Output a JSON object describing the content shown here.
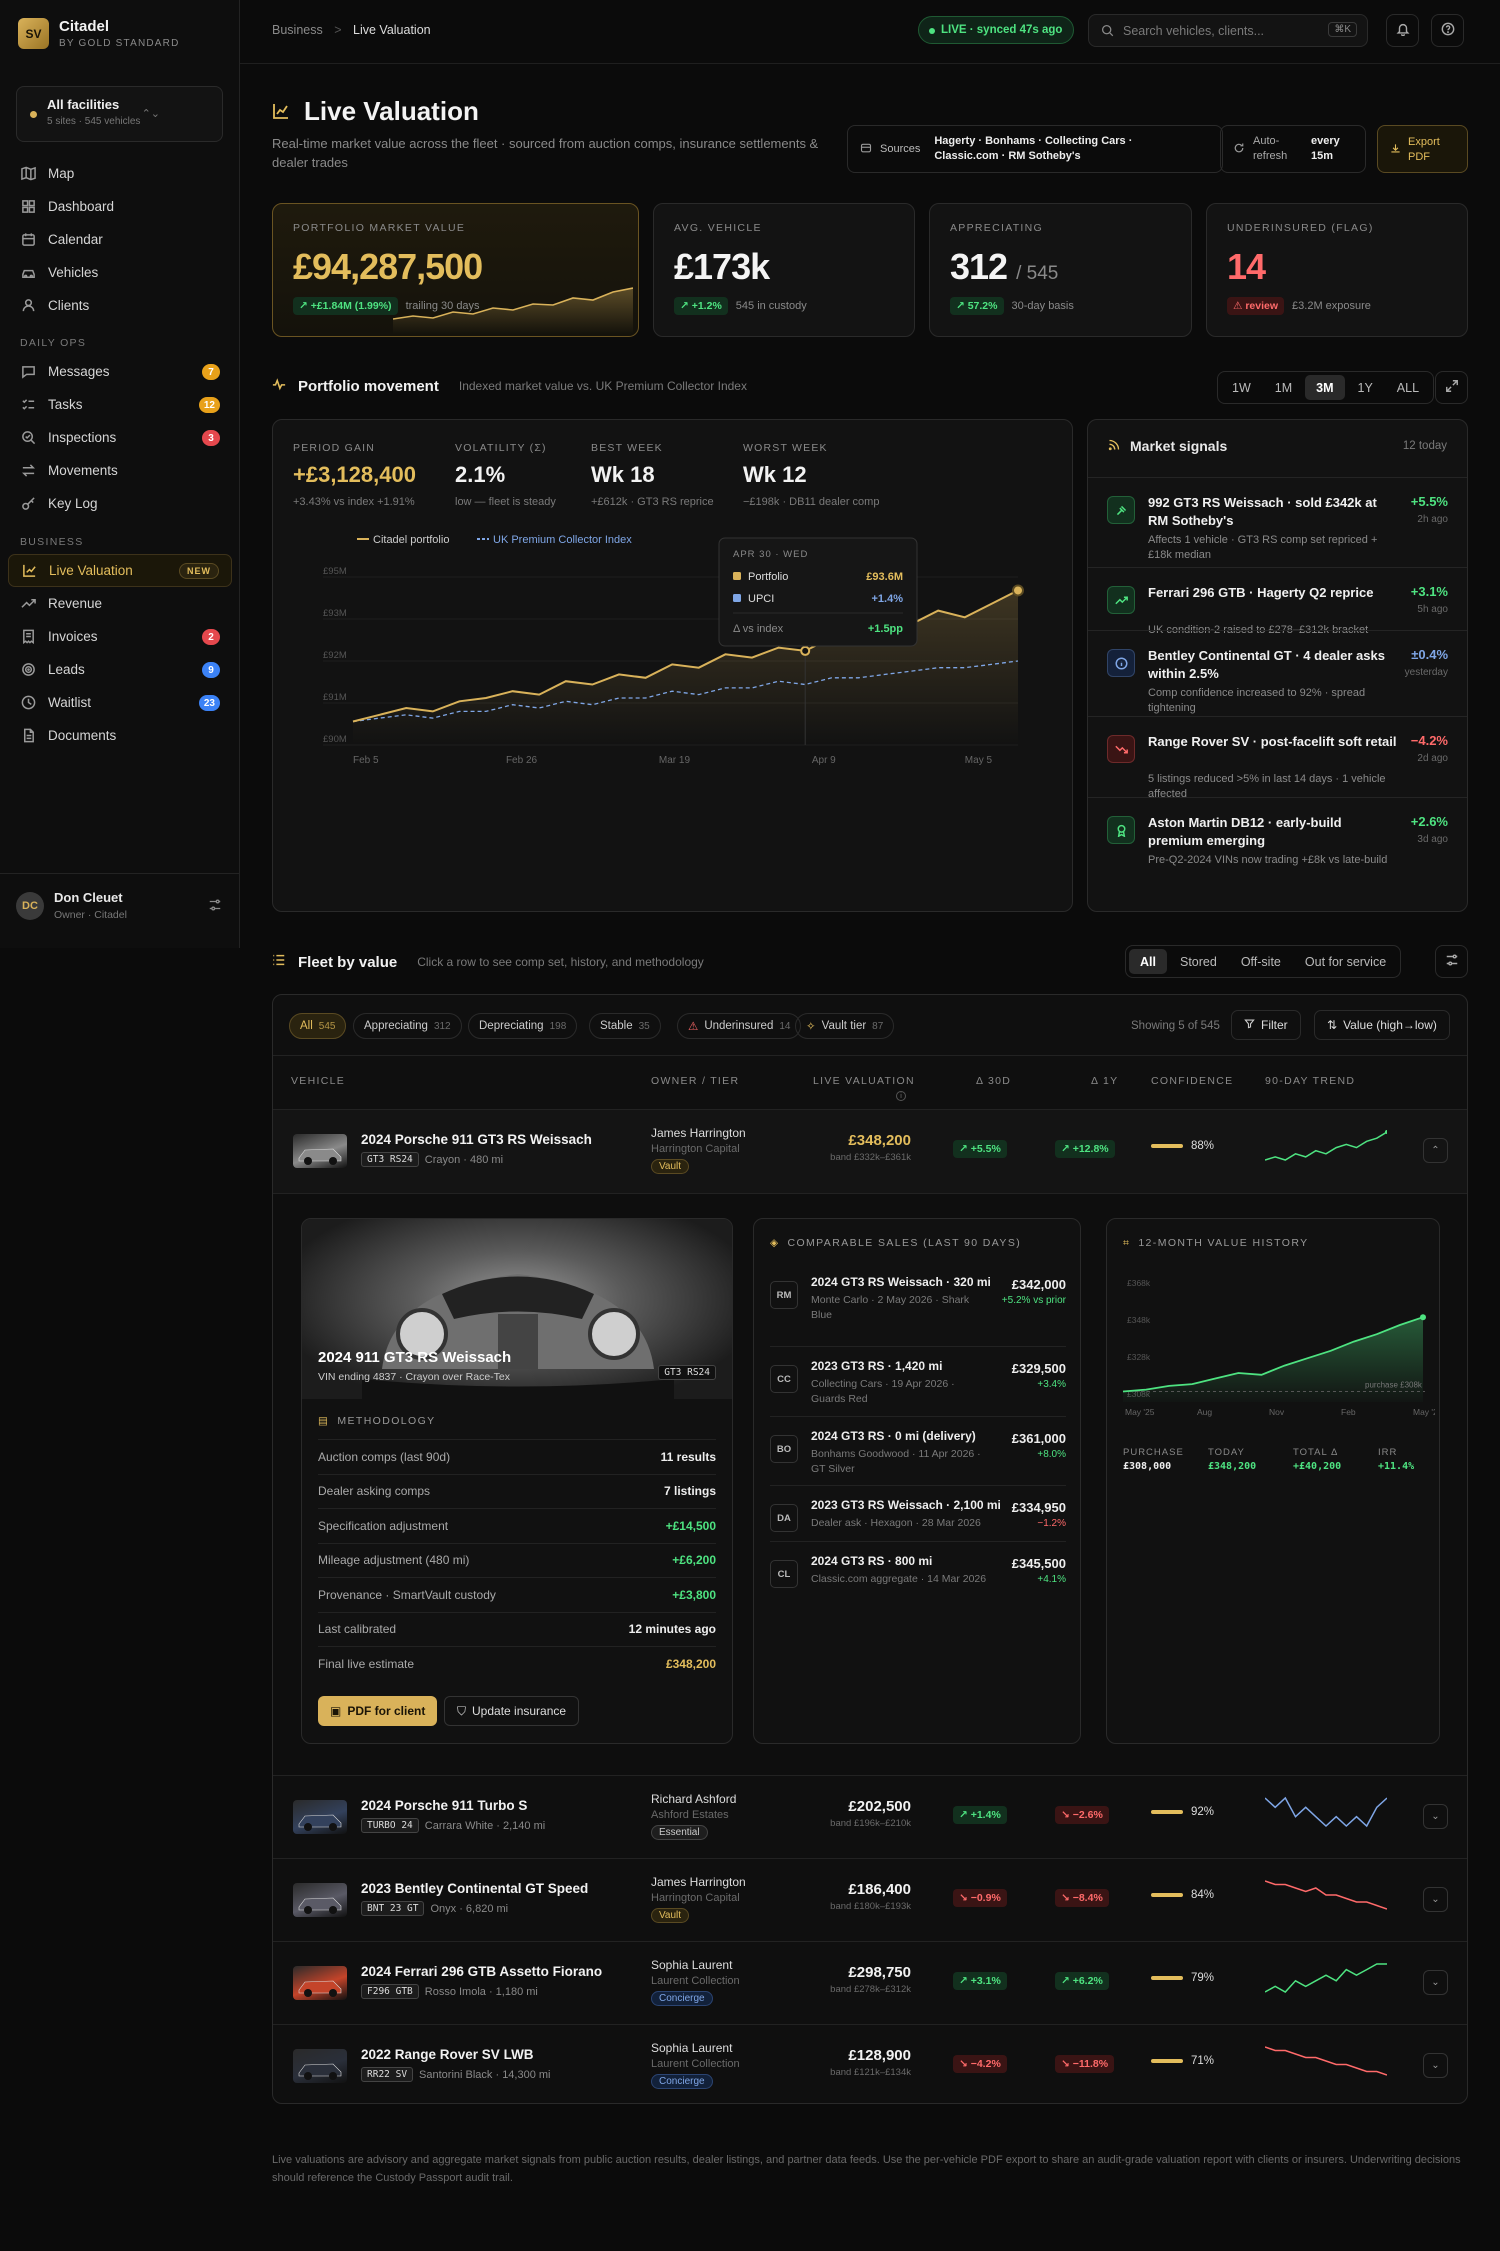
{
  "brand": {
    "logo": "SV",
    "name": "Citadel",
    "sub": "BY GOLD STANDARD"
  },
  "facility": {
    "title": "All facilities",
    "sub": "5 sites · 545 vehicles"
  },
  "nav_main": [
    {
      "label": "Map",
      "icon": "map-icon"
    },
    {
      "label": "Dashboard",
      "icon": "dashboard-icon"
    },
    {
      "label": "Calendar",
      "icon": "calendar-icon"
    },
    {
      "label": "Vehicles",
      "icon": "car-icon"
    },
    {
      "label": "Clients",
      "icon": "users-icon"
    }
  ],
  "nav_ops_title": "DAILY OPS",
  "nav_ops": [
    {
      "label": "Messages",
      "badge": "7",
      "badge_color": "#e8a11a"
    },
    {
      "label": "Tasks",
      "badge": "12",
      "badge_color": "#e8a11a"
    },
    {
      "label": "Inspections",
      "badge": "3",
      "badge_color": "#e5484d"
    },
    {
      "label": "Movements"
    },
    {
      "label": "Key Log"
    }
  ],
  "nav_biz_title": "BUSINESS",
  "nav_biz": [
    {
      "label": "Live Valuation",
      "tag": "NEW"
    },
    {
      "label": "Revenue"
    },
    {
      "label": "Invoices",
      "badge": "2",
      "badge_color": "#e5484d"
    },
    {
      "label": "Leads",
      "badge": "9",
      "badge_color": "#3b82f6"
    },
    {
      "label": "Waitlist",
      "badge": "23",
      "badge_color": "#3b82f6"
    },
    {
      "label": "Documents"
    }
  ],
  "user": {
    "initials": "DC",
    "name": "Don Cleuet",
    "role": "Owner · Citadel"
  },
  "breadcrumb": {
    "root": "Business",
    "sep": ">",
    "current": "Live Valuation"
  },
  "live_status": "LIVE · synced 47s ago",
  "search": {
    "placeholder": "Search vehicles, clients...",
    "kbd": "⌘K"
  },
  "page": {
    "title": "Live Valuation",
    "subtitle": "Real-time market value across the fleet · sourced from auction comps, insurance settlements & dealer trades"
  },
  "sources": {
    "label": "Sources",
    "value": "Hagerty · Bonhams · Collecting Cars · Classic.com · RM Sotheby's"
  },
  "autorefresh": {
    "label": "Auto-refresh",
    "value": "every 15m"
  },
  "export_label": "Export PDF",
  "kpis": [
    {
      "label": "PORTFOLIO MARKET VALUE",
      "value": "£94,287,500",
      "pill": "↗ +£1.84M (1.99%)",
      "note": "trailing 30 days"
    },
    {
      "label": "AVG. VEHICLE",
      "value": "£173k",
      "pill": "↗ +1.2%",
      "note": "545 in custody"
    },
    {
      "label": "APPRECIATING",
      "value": "312",
      "value_suffix": "/ 545",
      "pill": "↗ 57.2%",
      "note": "30-day basis"
    },
    {
      "label": "UNDERINSURED (FLAG)",
      "value": "14",
      "pill": "⚠ review",
      "note": "£3.2M exposure",
      "value_color": "#ff6a6a"
    }
  ],
  "movement": {
    "title": "Portfolio movement",
    "sub": "Indexed market value vs. UK Premium Collector Index",
    "ranges": [
      "1W",
      "1M",
      "3M",
      "1Y",
      "ALL"
    ],
    "active_range": "3M"
  },
  "movement_stats": [
    {
      "label": "PERIOD GAIN",
      "value": "+£3,128,400",
      "sub": "+3.43% vs index +1.91%",
      "color": "#e3bd5c"
    },
    {
      "label": "VOLATILITY (Σ)",
      "value": "2.1%",
      "sub": "low — fleet is steady"
    },
    {
      "label": "BEST WEEK",
      "value": "Wk 18",
      "sub": "+£612k · GT3 RS reprice"
    },
    {
      "label": "WORST WEEK",
      "value": "Wk 12",
      "sub": "−£198k · DB11 dealer comp"
    }
  ],
  "chart_data": {
    "type": "line",
    "legend": [
      "Citadel portfolio",
      "UK Premium Collector Index"
    ],
    "y_ticks": [
      "£95M",
      "£93M",
      "£92M",
      "£91M",
      "£90M"
    ],
    "ylim": [
      90,
      95
    ],
    "x_ticks": [
      "Feb 5",
      "Feb 26",
      "Mar 19",
      "Apr 9",
      "May 5"
    ],
    "series": [
      {
        "name": "Citadel portfolio",
        "color": "#d9b25a",
        "values": [
          90.7,
          90.9,
          91.1,
          91.0,
          91.3,
          91.4,
          91.6,
          91.5,
          91.9,
          91.8,
          92.1,
          92.0,
          92.4,
          92.3,
          92.7,
          92.6,
          92.9,
          92.8,
          93.2,
          93.1,
          93.5,
          93.6,
          94.0,
          93.8,
          94.2,
          94.6
        ]
      },
      {
        "name": "UK Premium Collector Index",
        "color": "#7fa6e6",
        "values": [
          90.7,
          90.8,
          90.9,
          90.8,
          91.0,
          91.0,
          91.2,
          91.1,
          91.3,
          91.2,
          91.4,
          91.4,
          91.6,
          91.5,
          91.7,
          91.7,
          91.9,
          91.8,
          92.0,
          92.0,
          92.1,
          92.2,
          92.3,
          92.3,
          92.4,
          92.5
        ]
      }
    ],
    "tooltip": {
      "date": "APR 30 · WED",
      "rows": [
        {
          "label": "Portfolio",
          "value": "£93.6M"
        },
        {
          "label": "UPCI",
          "value": "+1.4%"
        }
      ],
      "delta_label": "Δ vs index",
      "delta": "+1.5pp"
    }
  },
  "signals": {
    "title": "Market signals",
    "count": "12 today",
    "items": [
      {
        "title": "992 GT3 RS Weissach · sold £342k at RM Sotheby's",
        "desc": "Affects 1 vehicle · GT3 RS comp set repriced + £18k median",
        "pct": "+5.5%",
        "age": "2h ago",
        "tone": "up",
        "icon": "gavel-icon"
      },
      {
        "title": "Ferrari 296 GTB · Hagerty Q2 reprice",
        "desc": "UK condition-2 raised to £278–£312k bracket",
        "pct": "+3.1%",
        "age": "5h ago",
        "tone": "up",
        "icon": "trend-up-icon"
      },
      {
        "title": "Bentley Continental GT · 4 dealer asks within 2.5%",
        "desc": "Comp confidence increased to 92% · spread tightening",
        "pct": "±0.4%",
        "age": "yesterday",
        "tone": "flat",
        "icon": "info-icon"
      },
      {
        "title": "Range Rover SV · post-facelift soft retail",
        "desc": "5 listings reduced >5% in last 14 days · 1 vehicle affected",
        "pct": "−4.2%",
        "age": "2d ago",
        "tone": "down",
        "icon": "trend-down-icon"
      },
      {
        "title": "Aston Martin DB12 · early-build premium emerging",
        "desc": "Pre-Q2-2024 VINs now trading +£8k vs late-build",
        "pct": "+2.6%",
        "age": "3d ago",
        "tone": "up",
        "icon": "award-icon"
      }
    ]
  },
  "fleet": {
    "title": "Fleet by value",
    "sub": "Click a row to see comp set, history, and methodology",
    "tabs": [
      "All",
      "Stored",
      "Off-site",
      "Out for service"
    ],
    "active_tab": "All",
    "filters": [
      {
        "label": "All",
        "n": "545"
      },
      {
        "label": "Appreciating",
        "n": "312"
      },
      {
        "label": "Depreciating",
        "n": "198"
      },
      {
        "label": "Stable",
        "n": "35"
      },
      {
        "label": "Underinsured",
        "n": "14"
      },
      {
        "label": "Vault tier",
        "n": "87"
      }
    ],
    "showing": "Showing 5 of 545",
    "filter_btn": "Filter",
    "sort_btn": "Value (high→low)",
    "columns": [
      "VEHICLE",
      "OWNER / TIER",
      "LIVE VALUATION",
      "Δ 30D",
      "Δ 1Y",
      "CONFIDENCE",
      "90-DAY TREND"
    ],
    "rows": [
      {
        "name": "2024 Porsche 911 GT3 RS Weissach",
        "plate": "GT3 RS24",
        "spec": "Crayon · 480 mi",
        "owner": "James Harrington",
        "firm": "Harrington Capital",
        "tier": "Vault",
        "value": "£348,200",
        "band": "band £332k–£361k",
        "d30": "↗ +5.5%",
        "d1y": "↗ +12.8%",
        "conf": "88%",
        "up30": true,
        "up1y": true,
        "trend": [
          4,
          5,
          4,
          6,
          5,
          7,
          6,
          8,
          9,
          8,
          10,
          11,
          13
        ],
        "color": "#4ee381"
      },
      {
        "name": "2024 Porsche 911 Turbo S",
        "plate": "TURBO 24",
        "spec": "Carrara White · 2,140 mi",
        "owner": "Richard Ashford",
        "firm": "Ashford Estates",
        "tier": "Essential",
        "value": "£202,500",
        "band": "band £196k–£210k",
        "d30": "↗ +1.4%",
        "d1y": "↘ −2.6%",
        "conf": "92%",
        "up30": true,
        "up1y": false,
        "trend": [
          8,
          7,
          8,
          6,
          7,
          6,
          5,
          6,
          5,
          6,
          5,
          7,
          8
        ],
        "color": "#7fa6e6"
      },
      {
        "name": "2023 Bentley Continental GT Speed",
        "plate": "BNT 23 GT",
        "spec": "Onyx · 6,820 mi",
        "owner": "James Harrington",
        "firm": "Harrington Capital",
        "tier": "Vault",
        "value": "£186,400",
        "band": "band £180k–£193k",
        "d30": "↘ −0.9%",
        "d1y": "↘ −8.4%",
        "conf": "84%",
        "up30": false,
        "up1y": false,
        "trend": [
          12,
          11,
          11,
          10,
          9,
          10,
          8,
          8,
          7,
          6,
          6,
          5,
          4
        ],
        "color": "#ff6a6a"
      },
      {
        "name": "2024 Ferrari 296 GTB Assetto Fiorano",
        "plate": "F296 GTB",
        "spec": "Rosso Imola · 1,180 mi",
        "owner": "Sophia Laurent",
        "firm": "Laurent Collection",
        "tier": "Concierge",
        "value": "£298,750",
        "band": "band £278k–£312k",
        "d30": "↗ +3.1%",
        "d1y": "↗ +6.2%",
        "conf": "79%",
        "up30": true,
        "up1y": true,
        "trend": [
          5,
          6,
          5,
          7,
          6,
          7,
          8,
          7,
          9,
          8,
          9,
          10,
          10
        ],
        "color": "#4ee381"
      },
      {
        "name": "2022 Range Rover SV LWB",
        "plate": "RR22 SV",
        "spec": "Santorini Black · 14,300 mi",
        "owner": "Sophia Laurent",
        "firm": "Laurent Collection",
        "tier": "Concierge",
        "value": "£128,900",
        "band": "band £121k–£134k",
        "d30": "↘ −4.2%",
        "d1y": "↘ −11.8%",
        "conf": "71%",
        "up30": false,
        "up1y": false,
        "trend": [
          12,
          11,
          11,
          10,
          9,
          9,
          8,
          7,
          7,
          6,
          5,
          5,
          4
        ],
        "color": "#ff6a6a"
      }
    ]
  },
  "detail": {
    "hero_title": "2024 911 GT3 RS Weissach",
    "hero_sub": "VIN ending 4837 · Crayon over Race-Tex",
    "plate": "GT3 RS24",
    "methodology_title": "METHODOLOGY",
    "methodology": [
      {
        "label": "Auction comps (last 90d)",
        "value": "11 results"
      },
      {
        "label": "Dealer asking comps",
        "value": "7 listings"
      },
      {
        "label": "Specification adjustment",
        "value": "+£14,500",
        "color": "#4ee381"
      },
      {
        "label": "Mileage adjustment (480 mi)",
        "value": "+£6,200",
        "color": "#4ee381"
      },
      {
        "label": "Provenance · SmartVault custody",
        "value": "+£3,800",
        "color": "#4ee381"
      },
      {
        "label": "Last calibrated",
        "value": "12 minutes ago"
      },
      {
        "label": "Final live estimate",
        "value": "£348,200",
        "color": "#e3bd5c"
      }
    ],
    "pdf_btn": "PDF for client",
    "ins_btn": "Update insurance",
    "comps_title": "COMPARABLE SALES (LAST 90 DAYS)",
    "comps": [
      {
        "badge": "RM",
        "title": "2024 GT3 RS Weissach · 320 mi",
        "desc": "Monte Carlo · 2 May 2026 · Shark Blue",
        "price": "£342,000",
        "chg": "+5.2% vs prior"
      },
      {
        "badge": "CC",
        "title": "2023 GT3 RS · 1,420 mi",
        "desc": "Collecting Cars · 19 Apr 2026 · Guards Red",
        "price": "£329,500",
        "chg": "+3.4%"
      },
      {
        "badge": "BO",
        "title": "2024 GT3 RS · 0 mi (delivery)",
        "desc": "Bonhams Goodwood · 11 Apr 2026 · GT Silver",
        "price": "£361,000",
        "chg": "+8.0%"
      },
      {
        "badge": "DA",
        "title": "2023 GT3 RS Weissach · 2,100 mi",
        "desc": "Dealer ask · Hexagon · 28 Mar 2026",
        "price": "£334,950",
        "chg": "−1.2%",
        "neg": true
      },
      {
        "badge": "CL",
        "title": "2024 GT3 RS · 800 mi",
        "desc": "Classic.com aggregate · 14 Mar 2026",
        "price": "£345,500",
        "chg": "+4.1%"
      }
    ],
    "history_title": "12-MONTH VALUE HISTORY",
    "history": {
      "y_ticks": [
        "£368k",
        "£348k",
        "£328k",
        "£308k"
      ],
      "x_ticks": [
        "May '25",
        "Aug",
        "Nov",
        "Feb",
        "May '26"
      ],
      "purchase_label": "purchase £308k",
      "values": [
        308,
        309,
        311,
        312,
        315,
        318,
        317,
        322,
        326,
        330,
        335,
        339,
        344,
        348.2
      ]
    },
    "summary": [
      {
        "label": "PURCHASE",
        "value": "£308,000"
      },
      {
        "label": "TODAY",
        "value": "£348,200",
        "color": "#4ee381"
      },
      {
        "label": "TOTAL Δ",
        "value": "+£40,200",
        "color": "#4ee381"
      },
      {
        "label": "IRR",
        "value": "+11.4%",
        "color": "#4ee381"
      }
    ]
  },
  "footer": "Live valuations are advisory and aggregate market signals from public auction results, dealer listings, and partner data feeds. Use the per-vehicle PDF export to share an audit-grade valuation report with clients or insurers. Underwriting decisions should reference the Custody Passport audit trail."
}
